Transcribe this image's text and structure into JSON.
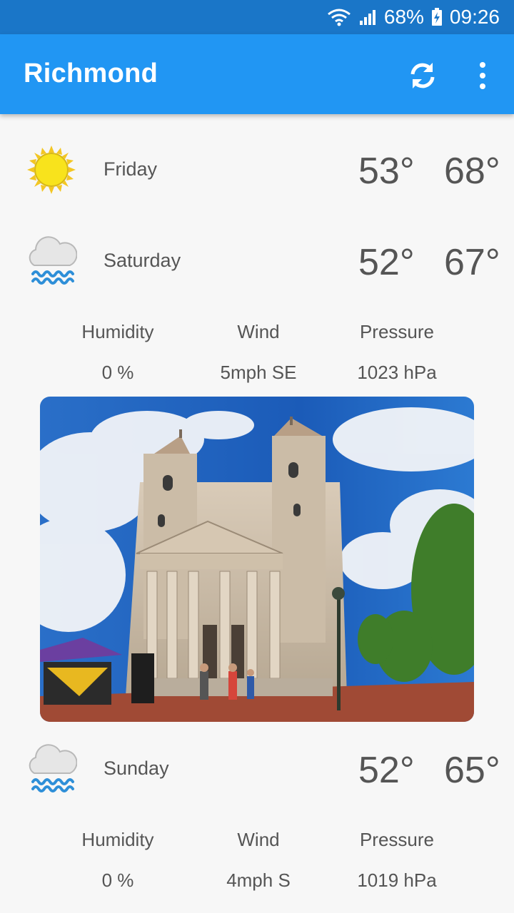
{
  "status_bar": {
    "battery": "68%",
    "time": "09:26"
  },
  "app_bar": {
    "title": "Richmond"
  },
  "forecast": [
    {
      "day": "Friday",
      "low": "53°",
      "high": "68°",
      "icon": "sun-icon"
    },
    {
      "day": "Saturday",
      "low": "52°",
      "high": "67°",
      "icon": "rain-cloud-icon",
      "details": {
        "humidity_label": "Humidity",
        "humidity": "0 %",
        "wind_label": "Wind",
        "wind": "5mph SE",
        "pressure_label": "Pressure",
        "pressure": "1023 hPa"
      }
    },
    {
      "day": "Sunday",
      "low": "52°",
      "high": "65°",
      "icon": "rain-cloud-icon",
      "details": {
        "humidity_label": "Humidity",
        "humidity": "0 %",
        "wind_label": "Wind",
        "wind": "4mph S",
        "pressure_label": "Pressure",
        "pressure": "1019 hPa"
      }
    }
  ],
  "colors": {
    "app_bar": "#2196f3",
    "status_bar": "#1a76c8",
    "text": "#555555"
  }
}
